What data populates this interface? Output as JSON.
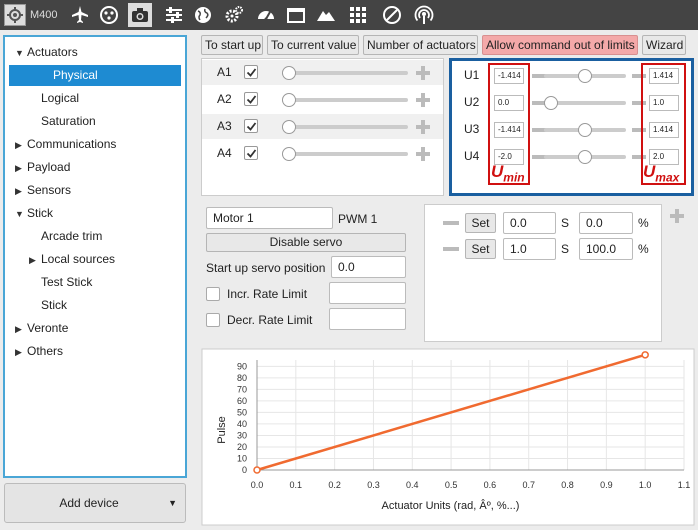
{
  "toolbar": {
    "device_name": "M400",
    "icons": [
      "device-icon",
      "airplane-icon",
      "dots-icon",
      "camera-icon",
      "sliders-icon",
      "globe-icon",
      "gears-icon",
      "gauge-icon",
      "window-icon",
      "mountain-icon",
      "grid-icon",
      "prohibited-icon",
      "signal-icon"
    ],
    "active_icon": "camera-icon"
  },
  "sidebar": {
    "items": [
      {
        "label": "Actuators",
        "level": 0,
        "arrow": "down"
      },
      {
        "label": "Physical",
        "level": 1,
        "arrow": "",
        "selected": true
      },
      {
        "label": "Logical",
        "level": 1,
        "arrow": ""
      },
      {
        "label": "Saturation",
        "level": 1,
        "arrow": ""
      },
      {
        "label": "Communications",
        "level": 0,
        "arrow": "right"
      },
      {
        "label": "Payload",
        "level": 0,
        "arrow": "right"
      },
      {
        "label": "Sensors",
        "level": 0,
        "arrow": "right"
      },
      {
        "label": "Stick",
        "level": 0,
        "arrow": "down"
      },
      {
        "label": "Arcade trim",
        "level": 1,
        "arrow": ""
      },
      {
        "label": "Local sources",
        "level": 1,
        "arrow": "right"
      },
      {
        "label": "Test Stick",
        "level": 1,
        "arrow": ""
      },
      {
        "label": "Stick",
        "level": 1,
        "arrow": ""
      },
      {
        "label": "Veronte",
        "level": 0,
        "arrow": "right"
      },
      {
        "label": "Others",
        "level": 0,
        "arrow": "right"
      }
    ],
    "add_device_label": "Add device"
  },
  "buttons": {
    "to_start_up": "To start up",
    "to_current_value": "To current value",
    "number_of_actuators": "Number of actuators",
    "allow_command": "Allow command out of limits",
    "wizard": "Wizard"
  },
  "actuators": [
    {
      "label": "A1",
      "checked": true,
      "value": 0.0
    },
    {
      "label": "A2",
      "checked": true,
      "value": 0.0
    },
    {
      "label": "A3",
      "checked": true,
      "value": 0.0
    },
    {
      "label": "A4",
      "checked": true,
      "value": 0.0
    }
  ],
  "limits": [
    {
      "label": "U1",
      "min": "-1.414",
      "max": "1.414",
      "position": 0.5
    },
    {
      "label": "U2",
      "min": "0.0",
      "max": "1.0",
      "position": 0.0
    },
    {
      "label": "U3",
      "min": "-1.414",
      "max": "1.414",
      "position": 0.5
    },
    {
      "label": "U4",
      "min": "-2.0",
      "max": "2.0",
      "position": 0.5
    }
  ],
  "limit_labels": {
    "umin": "U",
    "umin_sub": "min",
    "umax": "U",
    "umax_sub": "max"
  },
  "motor": {
    "name": "Motor 1",
    "pwm": "PWM 1",
    "disable_label": "Disable servo",
    "startup_label": "Start up servo position",
    "startup_value": "0.0",
    "incr_label": "Incr. Rate Limit",
    "decr_label": "Decr. Rate Limit"
  },
  "curve_points": [
    {
      "set_label": "Set",
      "s_value": "0.0",
      "s_unit": "S",
      "pct_value": "0.0",
      "pct_unit": "%"
    },
    {
      "set_label": "Set",
      "s_value": "1.0",
      "s_unit": "S",
      "pct_value": "100.0",
      "pct_unit": "%"
    }
  ],
  "colors": {
    "accent": "#1e8bd2",
    "limit_box": "#1a5fa0",
    "limit_markers": "#d01010",
    "pink_button": "#f4a9a9",
    "line": "#f06a30"
  },
  "chart_data": {
    "type": "line",
    "xlabel": "Actuator Units (rad, Âº, %...)",
    "ylabel": "Pulse",
    "xlim": [
      0,
      1.1
    ],
    "ylim": [
      0,
      100
    ],
    "xticks": [
      0.0,
      0.1,
      0.2,
      0.3,
      0.4,
      0.5,
      0.6,
      0.7,
      0.8,
      0.9,
      1.0,
      1.1
    ],
    "yticks": [
      0,
      10,
      20,
      30,
      40,
      50,
      60,
      70,
      80,
      90
    ],
    "series": [
      {
        "x": [
          0.0,
          1.0
        ],
        "values": [
          0,
          100
        ]
      }
    ],
    "grid": true
  }
}
